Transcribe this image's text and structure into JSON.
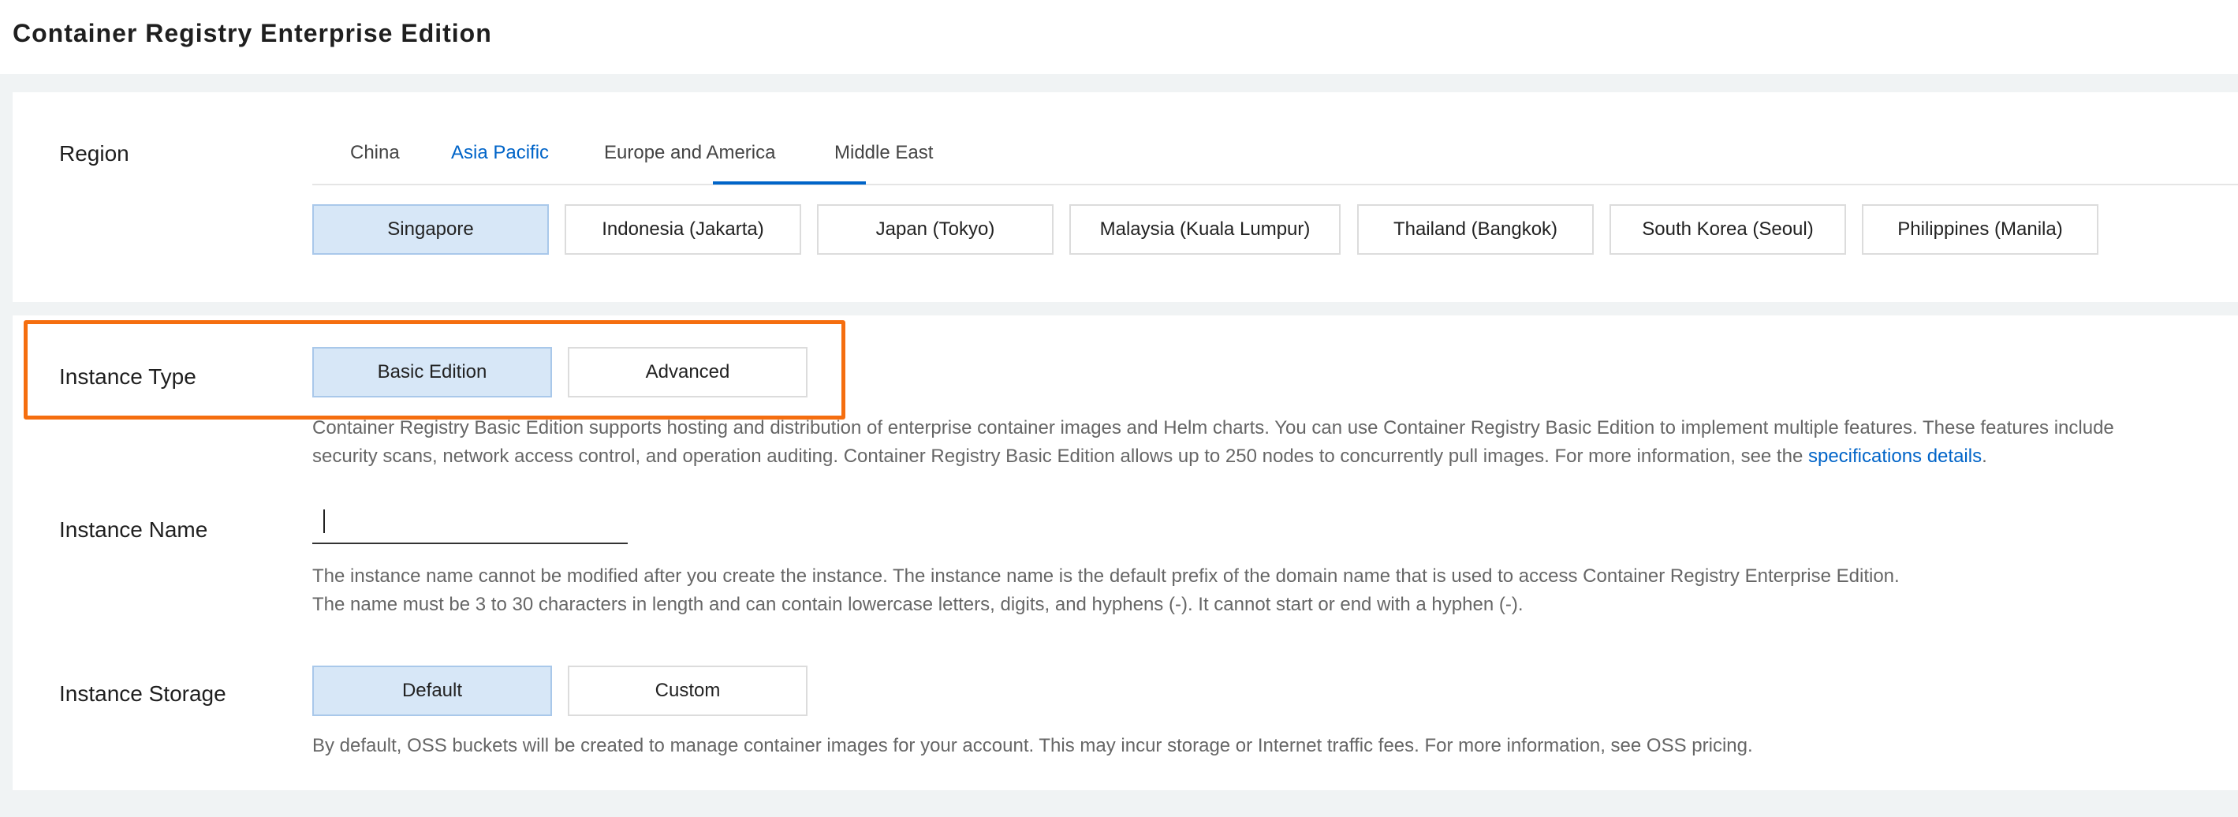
{
  "page": {
    "title": "Container Registry Enterprise Edition"
  },
  "region": {
    "label": "Region",
    "tabs": [
      "China",
      "Asia Pacific",
      "Europe and America",
      "Middle East"
    ],
    "active_tab": "Asia Pacific",
    "options": [
      "Singapore",
      "Indonesia (Jakarta)",
      "Japan (Tokyo)",
      "Malaysia (Kuala Lumpur)",
      "Thailand (Bangkok)",
      "South Korea (Seoul)",
      "Philippines (Manila)"
    ],
    "selected": "Singapore"
  },
  "instance_type": {
    "label": "Instance Type",
    "options": [
      "Basic Edition",
      "Advanced"
    ],
    "selected": "Basic Edition",
    "help_line1": "Container Registry Basic Edition supports hosting and distribution of enterprise container images and Helm charts. You can use Container Registry Basic Edition to implement multiple features. These features include",
    "help_line2": "security scans, network access control, and operation auditing. Container Registry Basic Edition allows up to 250 nodes to concurrently pull images. For more information, see the ",
    "help_link": "specifications details",
    "help_end": "."
  },
  "instance_name": {
    "label": "Instance Name",
    "value": "",
    "help_line1": "The instance name cannot be modified after you create the instance. The instance name is the default prefix of the domain name that is used to access Container Registry Enterprise Edition.",
    "help_line2": "The name must be 3 to 30 characters in length and can contain lowercase letters, digits, and hyphens (-). It cannot start or end with a hyphen (-)."
  },
  "instance_storage": {
    "label": "Instance Storage",
    "options": [
      "Default",
      "Custom"
    ],
    "selected": "Default",
    "help": "By default, OSS buckets will be created to manage container images for your account. This may incur storage or Internet traffic fees. For more information, see OSS pricing."
  },
  "colors": {
    "accent": "#0064c8",
    "selected_bg": "#d7e7f7",
    "highlight": "#f56e0f"
  }
}
